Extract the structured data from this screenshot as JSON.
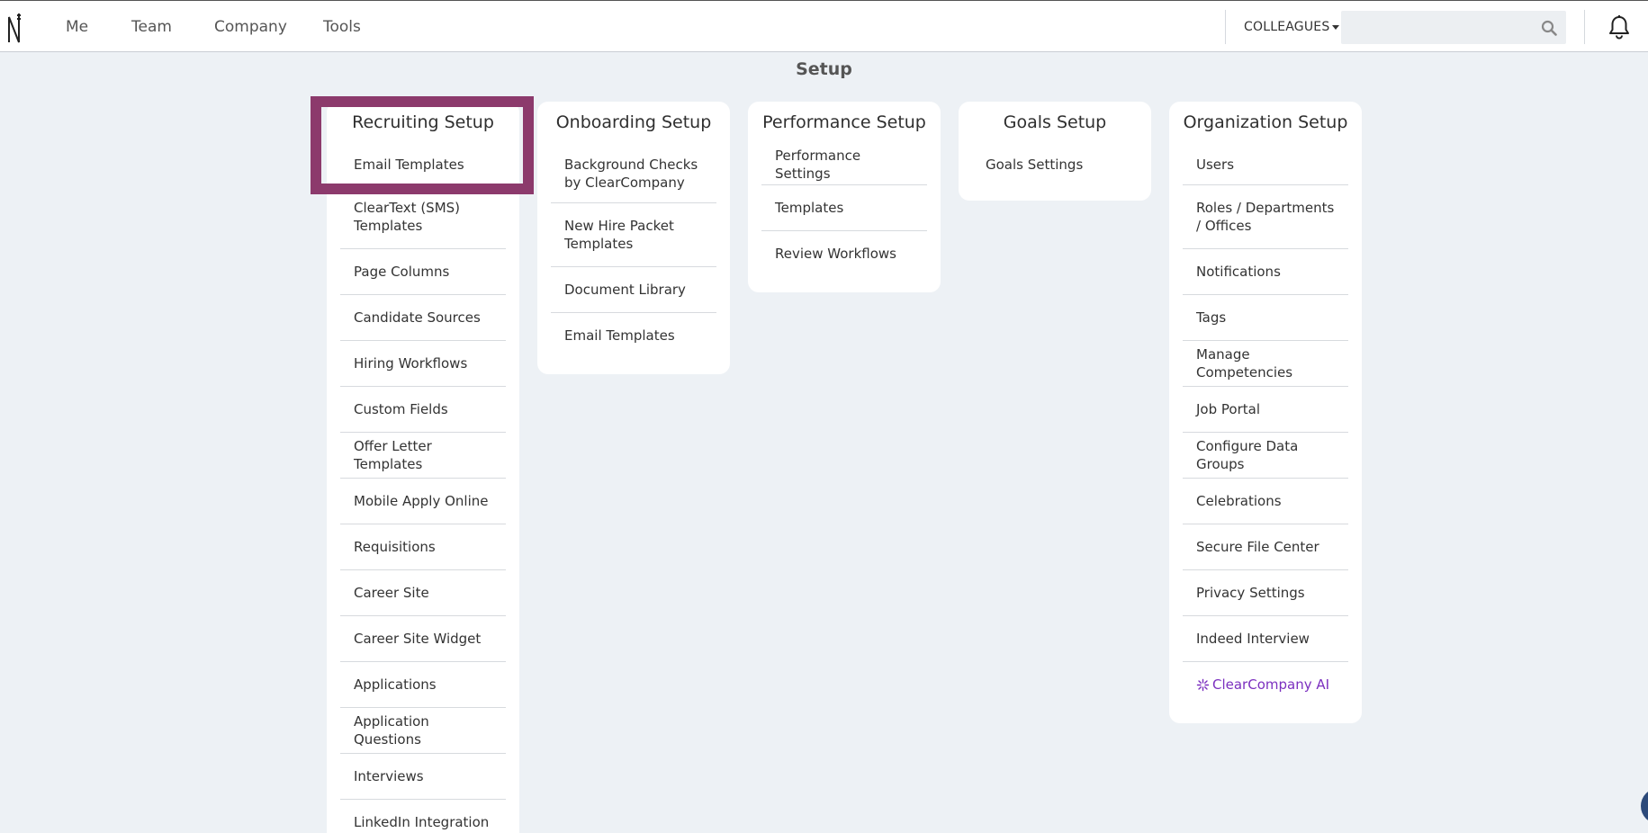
{
  "nav": {
    "items": [
      "Me",
      "Team",
      "Company",
      "Tools"
    ],
    "colleagues_label": "COLLEAGUES",
    "search_placeholder": "",
    "icons": [
      "logo-icon",
      "search-icon",
      "bell-icon"
    ]
  },
  "page": {
    "title": "Setup"
  },
  "columns": [
    {
      "title": "Recruiting Setup",
      "items": [
        "Email Templates",
        "ClearText (SMS) Templates",
        "Page Columns",
        "Candidate Sources",
        "Hiring Workflows",
        "Custom Fields",
        "Offer Letter Templates",
        "Mobile Apply Online",
        "Requisitions",
        "Career Site",
        "Career Site Widget",
        "Applications",
        "Application Questions",
        "Interviews",
        "LinkedIn Integration"
      ]
    },
    {
      "title": "Onboarding Setup",
      "items": [
        "Background Checks by ClearCompany",
        "New Hire Packet Templates",
        "Document Library",
        "Email Templates"
      ]
    },
    {
      "title": "Performance Setup",
      "items": [
        "Performance Settings",
        "Templates",
        "Review Workflows"
      ]
    },
    {
      "title": "Goals Setup",
      "items": [
        "Goals Settings"
      ]
    },
    {
      "title": "Organization Setup",
      "items": [
        "Users",
        "Roles / Departments / Offices",
        "Notifications",
        "Tags",
        "Manage Competencies",
        "Job Portal",
        "Configure Data Groups",
        "Celebrations",
        "Secure File Center",
        "Privacy Settings",
        "Indeed Interview",
        "ClearCompany AI"
      ]
    }
  ],
  "colors": {
    "highlight": "#8c3a6c",
    "ai_accent": "#7b2fbf",
    "background": "#edf1f5"
  }
}
